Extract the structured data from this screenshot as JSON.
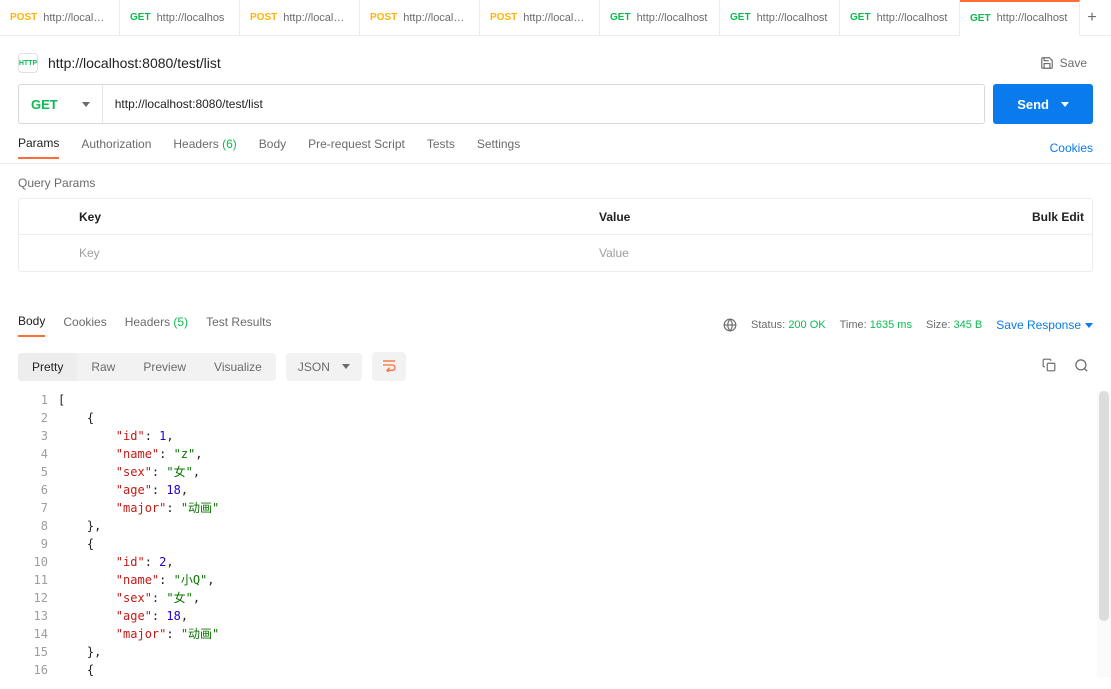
{
  "tabs": [
    {
      "method": "POST",
      "label": "http://localhos"
    },
    {
      "method": "GET",
      "label": "http://localhos"
    },
    {
      "method": "POST",
      "label": "http://localhos"
    },
    {
      "method": "POST",
      "label": "http://localhos"
    },
    {
      "method": "POST",
      "label": "http://localhos"
    },
    {
      "method": "GET",
      "label": "http://localhost"
    },
    {
      "method": "GET",
      "label": "http://localhost"
    },
    {
      "method": "GET",
      "label": "http://localhost"
    },
    {
      "method": "GET",
      "label": "http://localhost"
    }
  ],
  "activeTabIndex": 8,
  "header": {
    "http_badge": "HTTP",
    "title": "http://localhost:8080/test/list",
    "save_label": "Save"
  },
  "urlbar": {
    "method": "GET",
    "url": "http://localhost:8080/test/list",
    "send_label": "Send"
  },
  "reqTabs": {
    "params": "Params",
    "authorization": "Authorization",
    "headers": "Headers",
    "headers_count": "(6)",
    "body": "Body",
    "prerequest": "Pre-request Script",
    "tests": "Tests",
    "settings": "Settings",
    "cookies_link": "Cookies"
  },
  "queryParams": {
    "section": "Query Params",
    "keyHeader": "Key",
    "valueHeader": "Value",
    "bulkEdit": "Bulk Edit",
    "keyPlaceholder": "Key",
    "valuePlaceholder": "Value"
  },
  "respTabs": {
    "body": "Body",
    "cookies": "Cookies",
    "headers": "Headers",
    "headers_count": "(5)",
    "test_results": "Test Results"
  },
  "respMeta": {
    "status_label": "Status:",
    "status_value": "200 OK",
    "time_label": "Time:",
    "time_value": "1635 ms",
    "size_label": "Size:",
    "size_value": "345 B",
    "save_response": "Save Response"
  },
  "viewToolbar": {
    "pretty": "Pretty",
    "raw": "Raw",
    "preview": "Preview",
    "visualize": "Visualize",
    "format": "JSON"
  },
  "response_json": [
    {
      "id": 1,
      "name": "z",
      "sex": "女",
      "age": 18,
      "major": "动画"
    },
    {
      "id": 2,
      "name": "小Q",
      "sex": "女",
      "age": 18,
      "major": "动画"
    }
  ],
  "codeLines": [
    {
      "n": "1",
      "indent": 0,
      "tokens": [
        {
          "t": "[",
          "c": "p"
        }
      ]
    },
    {
      "n": "2",
      "indent": 1,
      "tokens": [
        {
          "t": "{",
          "c": "p"
        }
      ]
    },
    {
      "n": "3",
      "indent": 2,
      "tokens": [
        {
          "t": "\"id\"",
          "c": "k"
        },
        {
          "t": ": ",
          "c": "p"
        },
        {
          "t": "1",
          "c": "n"
        },
        {
          "t": ",",
          "c": "p"
        }
      ]
    },
    {
      "n": "4",
      "indent": 2,
      "tokens": [
        {
          "t": "\"name\"",
          "c": "k"
        },
        {
          "t": ": ",
          "c": "p"
        },
        {
          "t": "\"z\"",
          "c": "s"
        },
        {
          "t": ",",
          "c": "p"
        }
      ]
    },
    {
      "n": "5",
      "indent": 2,
      "tokens": [
        {
          "t": "\"sex\"",
          "c": "k"
        },
        {
          "t": ": ",
          "c": "p"
        },
        {
          "t": "\"女\"",
          "c": "s"
        },
        {
          "t": ",",
          "c": "p"
        }
      ]
    },
    {
      "n": "6",
      "indent": 2,
      "tokens": [
        {
          "t": "\"age\"",
          "c": "k"
        },
        {
          "t": ": ",
          "c": "p"
        },
        {
          "t": "18",
          "c": "n"
        },
        {
          "t": ",",
          "c": "p"
        }
      ]
    },
    {
      "n": "7",
      "indent": 2,
      "tokens": [
        {
          "t": "\"major\"",
          "c": "k"
        },
        {
          "t": ": ",
          "c": "p"
        },
        {
          "t": "\"动画\"",
          "c": "s"
        }
      ]
    },
    {
      "n": "8",
      "indent": 1,
      "tokens": [
        {
          "t": "},",
          "c": "p"
        }
      ]
    },
    {
      "n": "9",
      "indent": 1,
      "tokens": [
        {
          "t": "{",
          "c": "p"
        }
      ]
    },
    {
      "n": "10",
      "indent": 2,
      "tokens": [
        {
          "t": "\"id\"",
          "c": "k"
        },
        {
          "t": ": ",
          "c": "p"
        },
        {
          "t": "2",
          "c": "n"
        },
        {
          "t": ",",
          "c": "p"
        }
      ]
    },
    {
      "n": "11",
      "indent": 2,
      "tokens": [
        {
          "t": "\"name\"",
          "c": "k"
        },
        {
          "t": ": ",
          "c": "p"
        },
        {
          "t": "\"小Q\"",
          "c": "s"
        },
        {
          "t": ",",
          "c": "p"
        }
      ]
    },
    {
      "n": "12",
      "indent": 2,
      "tokens": [
        {
          "t": "\"sex\"",
          "c": "k"
        },
        {
          "t": ": ",
          "c": "p"
        },
        {
          "t": "\"女\"",
          "c": "s"
        },
        {
          "t": ",",
          "c": "p"
        }
      ]
    },
    {
      "n": "13",
      "indent": 2,
      "tokens": [
        {
          "t": "\"age\"",
          "c": "k"
        },
        {
          "t": ": ",
          "c": "p"
        },
        {
          "t": "18",
          "c": "n"
        },
        {
          "t": ",",
          "c": "p"
        }
      ]
    },
    {
      "n": "14",
      "indent": 2,
      "tokens": [
        {
          "t": "\"major\"",
          "c": "k"
        },
        {
          "t": ": ",
          "c": "p"
        },
        {
          "t": "\"动画\"",
          "c": "s"
        }
      ]
    },
    {
      "n": "15",
      "indent": 1,
      "tokens": [
        {
          "t": "},",
          "c": "p"
        }
      ]
    },
    {
      "n": "16",
      "indent": 1,
      "tokens": [
        {
          "t": "{",
          "c": "p"
        }
      ]
    }
  ]
}
